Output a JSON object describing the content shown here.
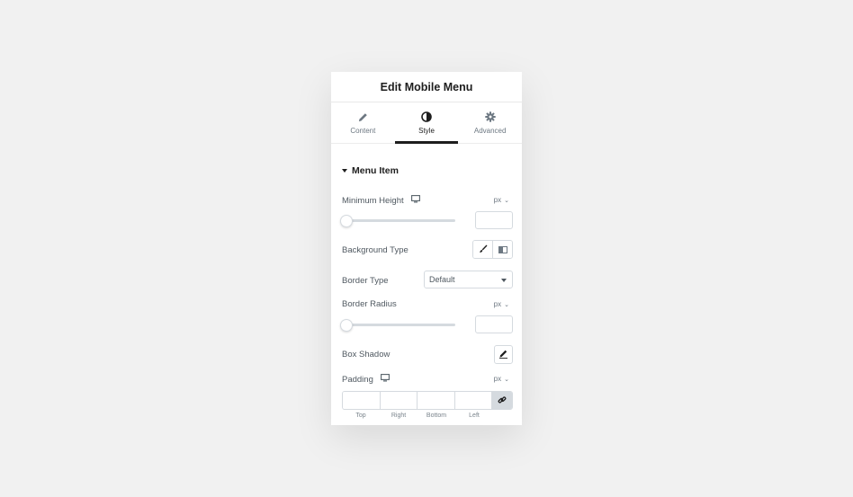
{
  "panel": {
    "title": "Edit Mobile Menu"
  },
  "tabs": [
    {
      "label": "Content",
      "icon": "pencil-icon"
    },
    {
      "label": "Style",
      "icon": "contrast-icon",
      "active": true
    },
    {
      "label": "Advanced",
      "icon": "gear-icon"
    }
  ],
  "section": {
    "title": "Menu Item",
    "expanded": true
  },
  "controls": {
    "min_height": {
      "label": "Minimum Height",
      "unit": "px",
      "value": "",
      "responsive_icon": "desktop-icon",
      "slider_fraction": 0
    },
    "background_type": {
      "label": "Background Type",
      "options": [
        "classic-brush-icon",
        "gradient-icon"
      ]
    },
    "border_type": {
      "label": "Border Type",
      "selected": "Default"
    },
    "border_radius": {
      "label": "Border Radius",
      "unit": "px",
      "value": "",
      "slider_fraction": 0
    },
    "box_shadow": {
      "label": "Box Shadow",
      "icon": "edit-icon"
    },
    "padding": {
      "label": "Padding",
      "unit": "px",
      "responsive_icon": "desktop-icon",
      "sides": [
        "Top",
        "Right",
        "Bottom",
        "Left"
      ],
      "link_icon": "link-icon"
    }
  },
  "colors": {
    "accent": "#1e1e1e",
    "border": "#d5dadf",
    "background": "#f1f1f1"
  }
}
